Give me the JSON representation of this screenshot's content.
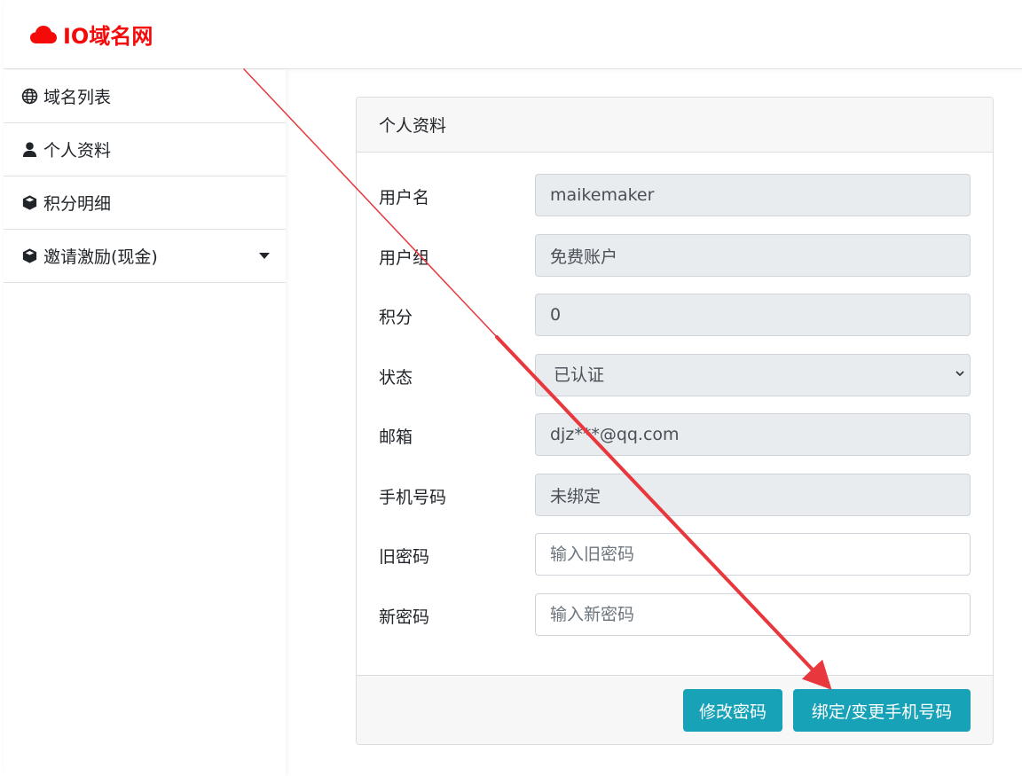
{
  "brand": {
    "name": "IO域名网",
    "color": "#f50a0a",
    "icon": "cloud-icon"
  },
  "sidebar": {
    "items": [
      {
        "label": "域名列表",
        "icon": "globe-icon"
      },
      {
        "label": "个人资料",
        "icon": "user-icon"
      },
      {
        "label": "积分明细",
        "icon": "cube-icon"
      },
      {
        "label": "邀请激励(现金)",
        "icon": "cube-icon",
        "has_dropdown": true
      }
    ]
  },
  "profile": {
    "title": "个人资料",
    "fields": {
      "username": {
        "label": "用户名",
        "value": "maikemaker"
      },
      "group": {
        "label": "用户组",
        "value": "免费账户"
      },
      "points": {
        "label": "积分",
        "value": "0"
      },
      "status": {
        "label": "状态",
        "value": "已认证"
      },
      "email": {
        "label": "邮箱",
        "value": "djz***@qq.com"
      },
      "phone": {
        "label": "手机号码",
        "value": "未绑定"
      },
      "old_password": {
        "label": "旧密码",
        "placeholder": "输入旧密码"
      },
      "new_password": {
        "label": "新密码",
        "placeholder": "输入新密码"
      }
    },
    "buttons": {
      "change_password": "修改密码",
      "bind_phone": "绑定/变更手机号码"
    }
  },
  "colors": {
    "accent": "#17a2b8",
    "annotation_arrow": "#e8383d"
  }
}
